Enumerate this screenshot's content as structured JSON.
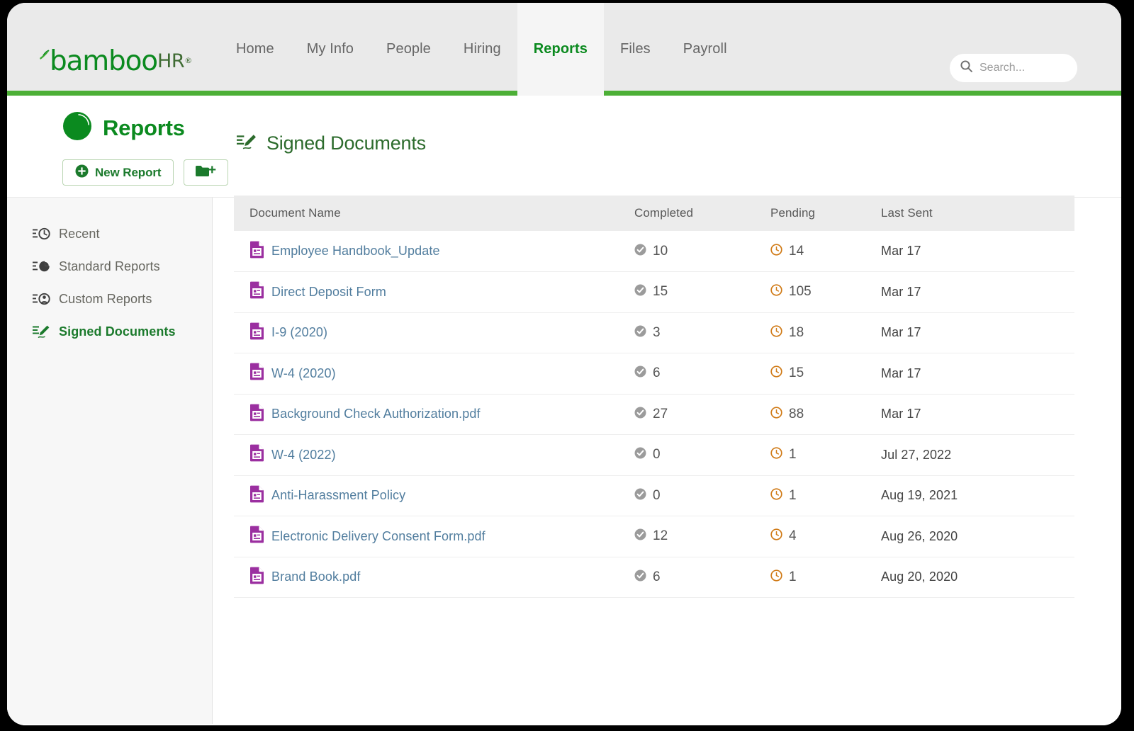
{
  "brand": {
    "logo_bamboo": "bamboo",
    "logo_hr": "HR",
    "logo_reg": "®",
    "green": "#0b8a1f",
    "accent_bar": "#4caf36"
  },
  "nav": {
    "items": [
      {
        "label": "Home",
        "active": false
      },
      {
        "label": "My Info",
        "active": false
      },
      {
        "label": "People",
        "active": false
      },
      {
        "label": "Hiring",
        "active": false
      },
      {
        "label": "Reports",
        "active": true
      },
      {
        "label": "Files",
        "active": false
      },
      {
        "label": "Payroll",
        "active": false
      }
    ]
  },
  "search": {
    "placeholder": "Search...",
    "value": "",
    "icon": "search-icon"
  },
  "page": {
    "title": "Reports",
    "title_icon": "pie-chart-icon"
  },
  "toolbar": {
    "new_report_label": "New Report",
    "new_report_icon": "plus-circle-icon",
    "new_folder_icon": "folder-plus-icon"
  },
  "sidebar": {
    "items": [
      {
        "label": "Recent",
        "icon": "list-clock-icon",
        "active": false
      },
      {
        "label": "Standard Reports",
        "icon": "list-pie-icon",
        "active": false
      },
      {
        "label": "Custom Reports",
        "icon": "list-person-icon",
        "active": false
      },
      {
        "label": "Signed Documents",
        "icon": "signature-icon",
        "active": true
      }
    ]
  },
  "main": {
    "section_title": "Signed Documents",
    "section_icon": "signature-icon",
    "table": {
      "columns": [
        "Document Name",
        "Completed",
        "Pending",
        "Last Sent"
      ],
      "row_icon": "document-icon",
      "completed_icon": "check-circle-icon",
      "pending_icon": "clock-circle-icon",
      "rows": [
        {
          "name": "Employee Handbook_Update",
          "completed": "10",
          "pending": "14",
          "last_sent": "Mar 17"
        },
        {
          "name": "Direct Deposit Form",
          "completed": "15",
          "pending": "105",
          "last_sent": "Mar 17"
        },
        {
          "name": "I-9 (2020)",
          "completed": "3",
          "pending": "18",
          "last_sent": "Mar 17"
        },
        {
          "name": "W-4 (2020)",
          "completed": "6",
          "pending": "15",
          "last_sent": "Mar 17"
        },
        {
          "name": "Background Check Authorization.pdf",
          "completed": "27",
          "pending": "88",
          "last_sent": "Mar 17"
        },
        {
          "name": "W-4 (2022)",
          "completed": "0",
          "pending": "1",
          "last_sent": "Jul 27, 2022"
        },
        {
          "name": "Anti-Harassment Policy",
          "completed": "0",
          "pending": "1",
          "last_sent": "Aug 19, 2021"
        },
        {
          "name": "Electronic Delivery Consent Form.pdf",
          "completed": "12",
          "pending": "4",
          "last_sent": "Aug 26, 2020"
        },
        {
          "name": "Brand Book.pdf",
          "completed": "6",
          "pending": "1",
          "last_sent": "Aug 20, 2020"
        }
      ]
    }
  },
  "colors": {
    "doc_icon": "#9b2fa0",
    "link": "#517d9e",
    "completed_icon": "#9b9b9b",
    "pending_icon": "#d07a16"
  }
}
